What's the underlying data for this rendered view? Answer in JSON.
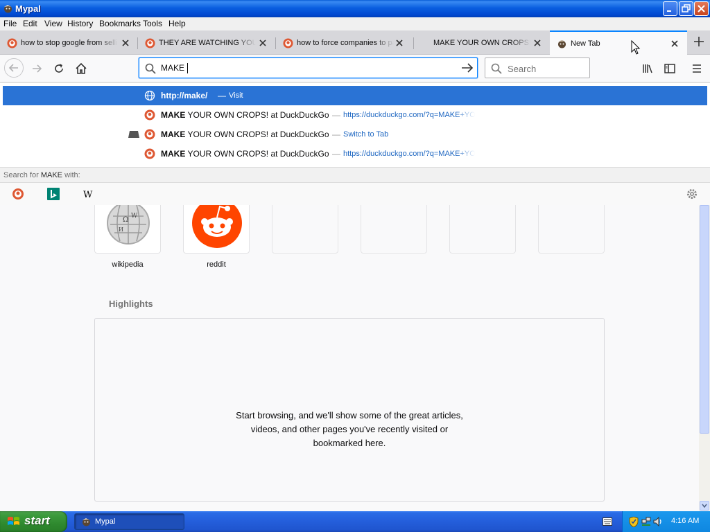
{
  "window": {
    "title": "Mypal"
  },
  "menu": [
    "File",
    "Edit",
    "View",
    "History",
    "Bookmarks",
    "Tools",
    "Help"
  ],
  "tabs": [
    {
      "label": "how to stop google from selling"
    },
    {
      "label": "THEY ARE WATCHING YOU! at"
    },
    {
      "label": "how to force companies to pay"
    },
    {
      "label": "MAKE YOUR OWN CROPS! at DuckDuckGo"
    },
    {
      "label": "New Tab"
    }
  ],
  "urlbar": {
    "value": "MAKE "
  },
  "searchbar": {
    "placeholder": "Search"
  },
  "suggestions": [
    {
      "bold": "http://make/",
      "rest": "",
      "action": "Visit"
    },
    {
      "bold": "MAKE",
      "rest": " YOUR OWN CROPS! at DuckDuckGo",
      "action": "https://duckduckgo.com/?q=MAKE+YOUR+OWN+CROPS"
    },
    {
      "bold": "MAKE",
      "rest": " YOUR OWN CROPS! at DuckDuckGo",
      "action": "Switch to Tab"
    },
    {
      "bold": "MAKE",
      "rest": " YOUR OWN CROPS! at DuckDuckGo",
      "action": "https://duckduckgo.com/?q=MAKE+YOUR+OWN+CROPS"
    }
  ],
  "search_for": {
    "prefix": "Search for",
    "term": "MAKE",
    "suffix": "with:"
  },
  "engines": [
    "duckduckgo-icon",
    "bing-icon",
    "wikipedia-icon"
  ],
  "top_sites": [
    {
      "label": "wikipedia"
    },
    {
      "label": "reddit"
    }
  ],
  "highlights": {
    "title": "Highlights",
    "message_line1": "Start browsing, and we'll show some of the great articles,",
    "message_line2": "videos, and other pages you've recently visited or",
    "message_line3": "bookmarked here."
  },
  "taskbar": {
    "start_label": "start",
    "task_label": "Mypal",
    "clock": "4:16 AM"
  },
  "colors": {
    "accent": "#0a84ff",
    "selected_row": "#2a73d5",
    "url_blue": "#1d66c1"
  }
}
